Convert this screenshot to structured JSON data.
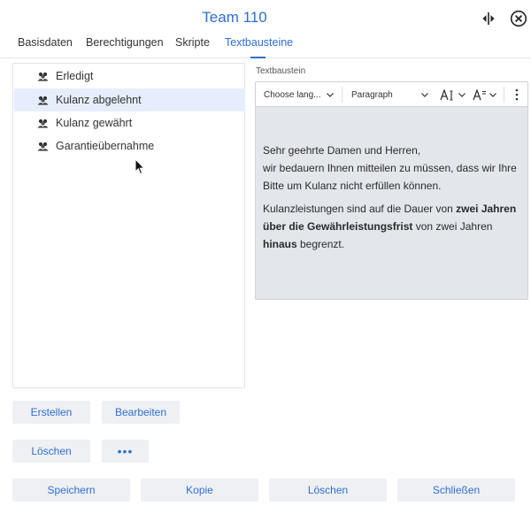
{
  "header": {
    "title": "Team 110",
    "expand_icon": "resize-horizontal-icon",
    "close_icon": "close-circle-icon"
  },
  "tabs": [
    {
      "label": "Basisdaten",
      "active": false
    },
    {
      "label": "Berechtigungen",
      "active": false
    },
    {
      "label": "Skripte",
      "active": false
    },
    {
      "label": "Textbausteine",
      "active": true
    }
  ],
  "list": {
    "item_icon": "users-group-icon",
    "items": [
      {
        "label": "Erledigt",
        "selected": false
      },
      {
        "label": "Kulanz abgelehnt",
        "selected": true
      },
      {
        "label": "Kulanz gewährt",
        "selected": false
      },
      {
        "label": "Garantieübernahme",
        "selected": false
      }
    ]
  },
  "editor": {
    "label": "Textbaustein",
    "toolbar": {
      "language": "Choose lang...",
      "paragraph": "Paragraph",
      "font_size_icon": "font-size-icon",
      "font_style_icon": "font-style-icon",
      "more_icon": "vertical-dots-icon"
    },
    "content": {
      "p1_line1": "Sehr geehrte Damen und Herren,",
      "p1_line2": "wir bedauern Ihnen mitteilen zu müssen, dass wir Ihre Bitte um Kulanz nicht erfüllen können.",
      "p2_part1": "Kulanzleistungen sind auf die Dauer von ",
      "p2_bold1": "zwei Jahren über die Gewährleistungsfrist",
      "p2_part2": " von zwei Jahren ",
      "p2_bold2": "hinaus",
      "p2_part3": " begrenzt."
    }
  },
  "list_buttons": {
    "create": "Erstellen",
    "edit": "Bearbeiten",
    "delete": "Löschen",
    "more": "•••"
  },
  "footer": {
    "save": "Speichern",
    "copy": "Kopie",
    "delete": "Löschen",
    "close": "Schließen"
  },
  "colors": {
    "accent": "#2e6fd1",
    "selected_row": "#e7eefb",
    "editor_bg": "#e3e6eb",
    "button_bg": "#eef0f3"
  }
}
